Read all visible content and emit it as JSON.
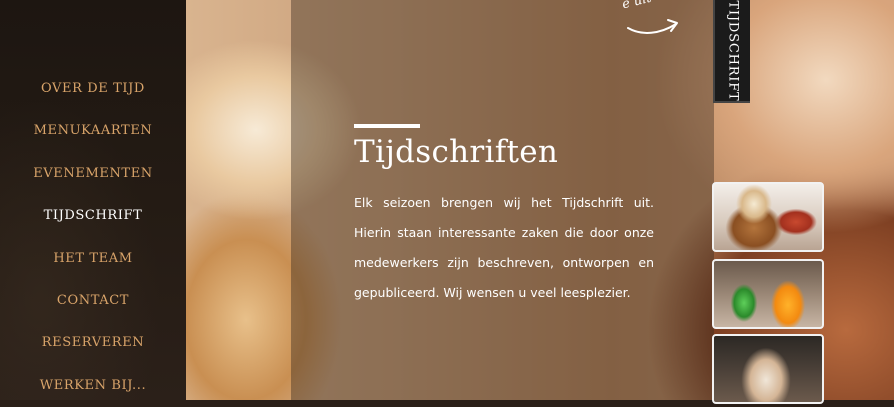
{
  "nav": {
    "items": [
      {
        "label": "OVER DE TIJD"
      },
      {
        "label": "MENUKAARTEN"
      },
      {
        "label": "EVENEMENTEN"
      },
      {
        "label": "TIJDSCHRIFT"
      },
      {
        "label": "HET TEAM"
      },
      {
        "label": "CONTACT"
      },
      {
        "label": "RESERVEREN"
      },
      {
        "label": "WERKEN BIJ..."
      }
    ],
    "active_index": 3
  },
  "content": {
    "title": "Tijdschriften",
    "body": "Elk seizoen brengen wij het Tijdschrift uit. Hierin staan interessante zaken die door onze medewerkers  zijn beschreven, ontworpen en gepubliceerd. Wij wensen u veel leesplezier."
  },
  "top_note": "e uit",
  "vertical_tab": {
    "label": "TIJDSCHRIFT"
  },
  "thumbnails": [
    {
      "name": "dessert-thumbnail"
    },
    {
      "name": "drinks-thumbnail"
    },
    {
      "name": "latte-thumbnail"
    }
  ],
  "colors": {
    "nav_link": "#d9a46a",
    "nav_active": "#ffffff",
    "sidebar_bg": "#1d1611",
    "panel_overlay": "rgba(58,42,30,0.42)"
  }
}
